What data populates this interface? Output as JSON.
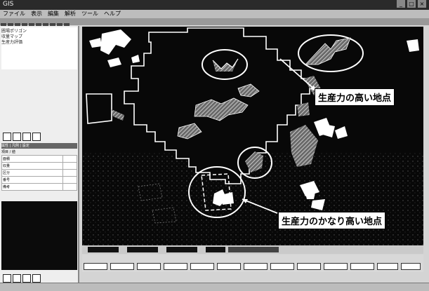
{
  "window": {
    "title": "GIS",
    "controls": [
      "_",
      "□",
      "×"
    ]
  },
  "menu": {
    "items": [
      "ファイル",
      "表示",
      "編集",
      "解析",
      "ツール",
      "ヘルプ"
    ]
  },
  "layers": {
    "items": [
      "圃場ポリゴン",
      "収量マップ",
      "生産力評価"
    ]
  },
  "properties": {
    "tabs": "属性 | 凡例 | 設定",
    "header": "項目 / 値",
    "rows": [
      {
        "key": "面積",
        "value": ""
      },
      {
        "key": "収量",
        "value": ""
      },
      {
        "key": "区分",
        "value": ""
      },
      {
        "key": "番号",
        "value": ""
      },
      {
        "key": "備考",
        "value": ""
      }
    ]
  },
  "annotations": {
    "high": "生産力の高い地点",
    "very_high": "生産力のかなり高い地点"
  },
  "colors": {
    "map_bg": "#080808",
    "field_outline": "#ffffff",
    "callout_bg": "#ffffff",
    "hatch": "#bfbfbf"
  },
  "status": {
    "center": "",
    "right": ""
  }
}
